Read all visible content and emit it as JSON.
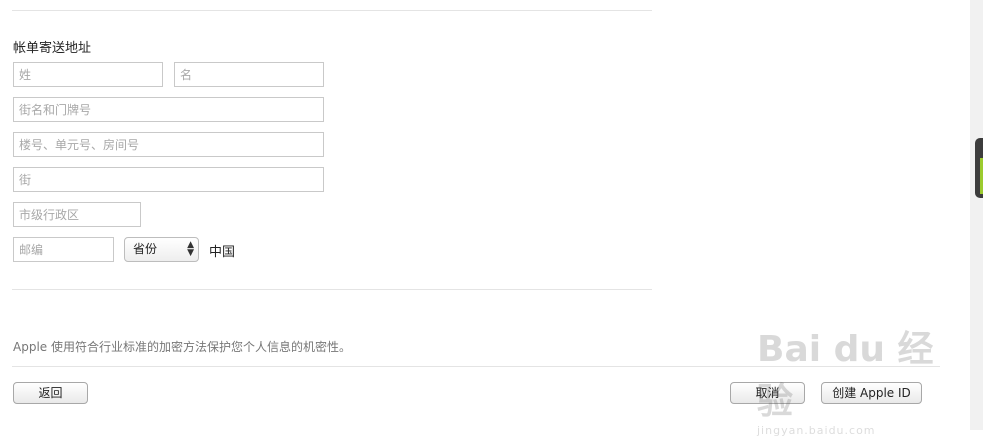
{
  "billing": {
    "section_title": "帐单寄送地址",
    "last_name_placeholder": "姓",
    "first_name_placeholder": "名",
    "street_placeholder": "街名和门牌号",
    "building_placeholder": "楼号、单元号、房间号",
    "street2_placeholder": "街",
    "district_placeholder": "市级行政区",
    "postcode_placeholder": "邮编",
    "province_selected": "省份",
    "country": "中国"
  },
  "notice": "Apple 使用符合行业标准的加密方法保护您个人信息的机密性。",
  "footer": {
    "back_label": "返回",
    "cancel_label": "取消",
    "create_label": "创建 Apple ID"
  },
  "watermark": {
    "brand": "Bai du 经验",
    "url": "jingyan.baidu.com"
  }
}
